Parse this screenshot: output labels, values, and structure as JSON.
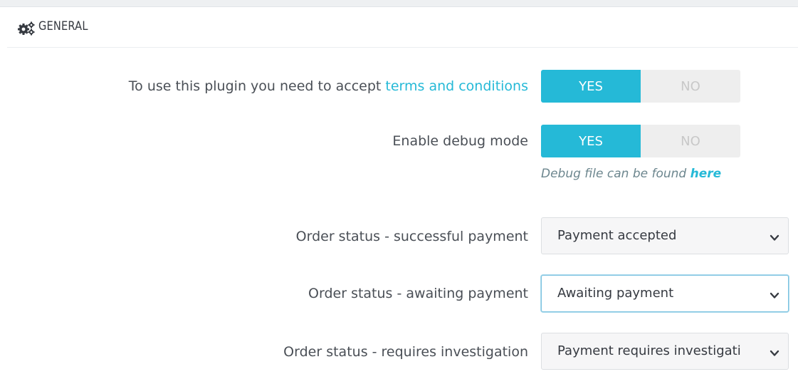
{
  "section": {
    "title": "GENERAL",
    "icon": "cogs-icon"
  },
  "terms": {
    "label_prefix": "To use this plugin you need to accept ",
    "link_text": "terms and conditions",
    "yes_label": "YES",
    "no_label": "NO",
    "selected": "YES"
  },
  "debug": {
    "label": "Enable debug mode",
    "yes_label": "YES",
    "no_label": "NO",
    "selected": "YES",
    "help_prefix": "Debug file can be found ",
    "help_link": "here"
  },
  "order_status": {
    "successful": {
      "label": "Order status - successful payment",
      "value": "Payment accepted"
    },
    "awaiting": {
      "label": "Order status - awaiting payment",
      "value": "Awaiting payment"
    },
    "investigation": {
      "label": "Order status - requires investigation",
      "value": "Payment requires investigati"
    }
  },
  "colors": {
    "accent": "#25b9d7",
    "toggle_off": "#eeeeee",
    "label_text": "#4a4f56"
  }
}
